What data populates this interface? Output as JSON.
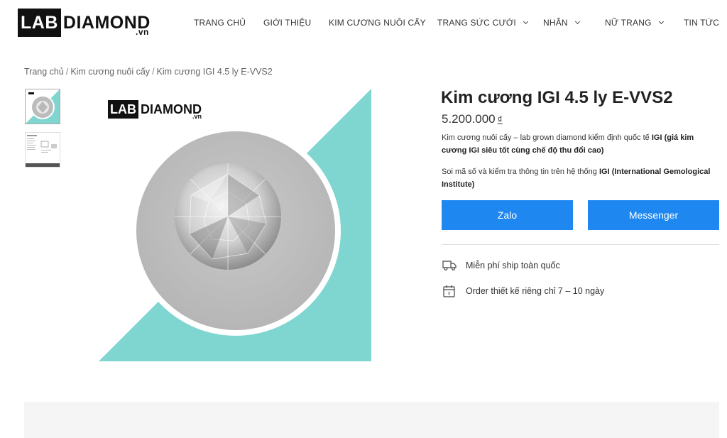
{
  "header": {
    "logo": {
      "lab": "LAB",
      "diamond": "DIAMOND",
      "vn": ".vn"
    },
    "nav": [
      {
        "label": "TRANG CHỦ",
        "has_dropdown": false
      },
      {
        "label": "GIỚI THIỆU",
        "has_dropdown": false
      },
      {
        "label": "KIM CƯƠNG NUÔI CẤY",
        "has_dropdown": false
      },
      {
        "label": "TRANG SỨC CƯỚI",
        "has_dropdown": true
      },
      {
        "label": "NHẪN",
        "has_dropdown": true
      },
      {
        "label": "NỮ TRANG",
        "has_dropdown": true
      },
      {
        "label": "TIN TỨC",
        "has_dropdown": false
      }
    ]
  },
  "breadcrumb": {
    "items": [
      "Trang chủ",
      "Kim cương nuôi cấy",
      "Kim cương IGI 4.5 ly E-VVS2"
    ],
    "separator": "/"
  },
  "gallery": {
    "thumbnails": [
      {
        "icon": "diamond-thumbnail-icon",
        "selected": true
      },
      {
        "icon": "certificate-thumbnail-icon",
        "selected": false
      }
    ],
    "image_logo": {
      "lab": "LAB",
      "diamond": "DIAMOND",
      "vn": ".vn"
    },
    "colors": {
      "teal": "#7fd5cf",
      "gray_disc": "#bcbcbc",
      "ring": "#ffffff"
    }
  },
  "product": {
    "title": "Kim cương IGI 4.5 ly E-VVS2",
    "price": "5.200.000",
    "currency": "₫",
    "desc1_plain": "Kim cương nuôi cấy – lab grown diamond kiểm định quốc tế ",
    "desc1_bold": "IGI (giá kim cương IGI siêu tốt cùng chế độ thu đổi cao)",
    "desc2_plain": "Soi mã số và kiểm tra thông tin trên hệ thống ",
    "desc2_bold": "IGI (International Gemological Institute)",
    "buttons": {
      "zalo": "Zalo",
      "messenger": "Messenger"
    },
    "button_color": "#1e88f0",
    "features": [
      {
        "icon": "truck-icon",
        "text": "Miễn phí ship toàn quốc"
      },
      {
        "icon": "calendar-icon",
        "text": "Order thiết kế riêng chỉ 7 – 10 ngày"
      }
    ]
  }
}
